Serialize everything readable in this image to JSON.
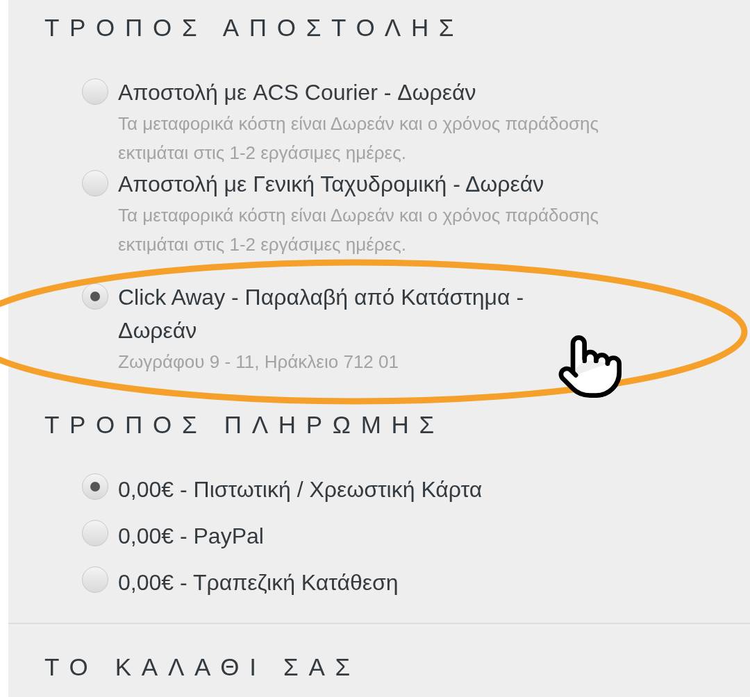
{
  "shipping": {
    "heading": "ΤΡΟΠΟΣ ΑΠΟΣΤΟΛΗΣ",
    "options": [
      {
        "label": "Αποστολή με ACS Courier - Δωρεάν",
        "description": "Τα μεταφορικά κόστη είναι Δωρεάν και ο χρόνος παράδοσης εκτιμάται στις 1-2 εργάσιμες ημέρες.",
        "selected": false
      },
      {
        "label": "Αποστολή με Γενική Ταχυδρομική - Δωρεάν",
        "description": "Τα μεταφορικά κόστη είναι Δωρεάν και ο χρόνος παράδοσης εκτιμάται στις 1-2 εργάσιμες ημέρες.",
        "selected": false
      },
      {
        "label": "Click Away - Παραλαβή από Κατάστημα - Δωρεάν",
        "description": "Ζωγράφου 9 - 11, Ηράκλειο 712 01",
        "selected": true
      }
    ]
  },
  "payment": {
    "heading": "ΤΡΟΠΟΣ ΠΛΗΡΩΜΗΣ",
    "options": [
      {
        "label": "0,00€ - Πιστωτική / Χρεωστική Κάρτα",
        "selected": true
      },
      {
        "label": "0,00€ - PayPal",
        "selected": false
      },
      {
        "label": "0,00€ - Τραπεζική Κατάθεση",
        "selected": false
      }
    ]
  },
  "cart": {
    "heading": "ΤΟ ΚΑΛΑΘΙ ΣΑΣ"
  }
}
